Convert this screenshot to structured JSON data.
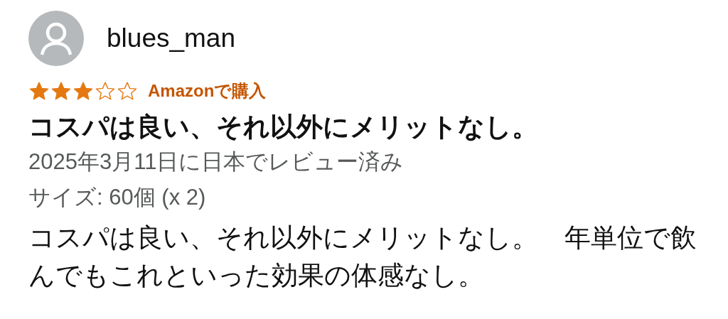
{
  "review": {
    "username": "blues_man",
    "stars": 3,
    "badge": "Amazonで購入",
    "title": "コスパは良い、それ以外にメリットなし。",
    "date": "2025年3月11日に日本でレビュー済み",
    "variant": "サイズ: 60個 (x 2)",
    "body": "コスパは良い、それ以外にメリットなし。　年単位で飲んでもこれといった効果の体感なし。"
  }
}
